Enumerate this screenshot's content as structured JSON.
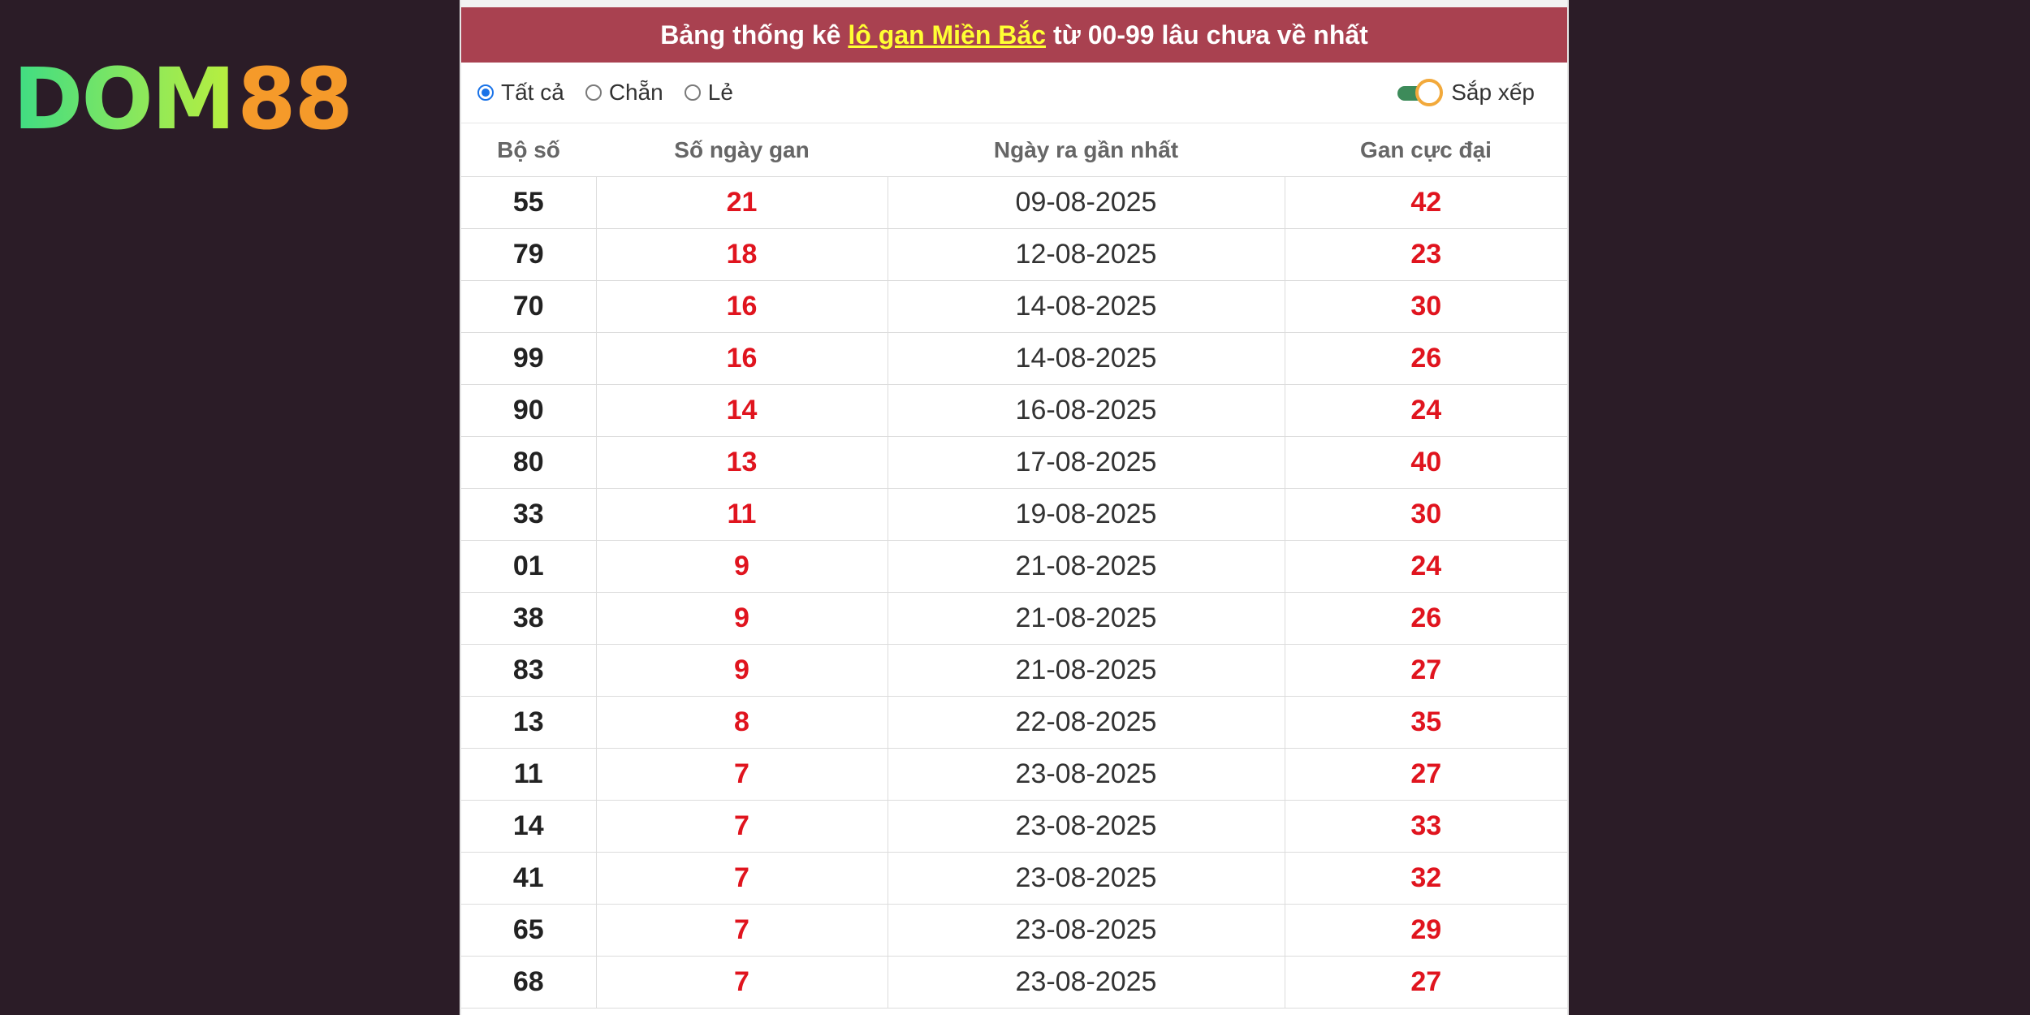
{
  "logo": {
    "part1": "DOM",
    "part2": "88"
  },
  "header": {
    "prefix": "Bảng thống kê",
    "highlight": "lô gan Miền Bắc",
    "suffix": "từ 00-99 lâu chưa về nhất"
  },
  "filters": {
    "options": [
      {
        "label": "Tất cả",
        "checked": true
      },
      {
        "label": "Chẵn",
        "checked": false
      },
      {
        "label": "Lẻ",
        "checked": false
      }
    ],
    "sort_label": "Sắp xếp",
    "sort_on": true
  },
  "table": {
    "columns": [
      "Bộ số",
      "Số ngày gan",
      "Ngày ra gần nhất",
      "Gan cực đại"
    ],
    "rows": [
      [
        "55",
        "21",
        "09-08-2025",
        "42"
      ],
      [
        "79",
        "18",
        "12-08-2025",
        "23"
      ],
      [
        "70",
        "16",
        "14-08-2025",
        "30"
      ],
      [
        "99",
        "16",
        "14-08-2025",
        "26"
      ],
      [
        "90",
        "14",
        "16-08-2025",
        "24"
      ],
      [
        "80",
        "13",
        "17-08-2025",
        "40"
      ],
      [
        "33",
        "11",
        "19-08-2025",
        "30"
      ],
      [
        "01",
        "9",
        "21-08-2025",
        "24"
      ],
      [
        "38",
        "9",
        "21-08-2025",
        "26"
      ],
      [
        "83",
        "9",
        "21-08-2025",
        "27"
      ],
      [
        "13",
        "8",
        "22-08-2025",
        "35"
      ],
      [
        "11",
        "7",
        "23-08-2025",
        "27"
      ],
      [
        "14",
        "7",
        "23-08-2025",
        "33"
      ],
      [
        "41",
        "7",
        "23-08-2025",
        "32"
      ],
      [
        "65",
        "7",
        "23-08-2025",
        "29"
      ],
      [
        "68",
        "7",
        "23-08-2025",
        "27"
      ]
    ]
  },
  "colors": {
    "background": "#2b1c27",
    "header_bar": "#a94150",
    "highlight": "#ffff33",
    "red_value": "#e0141e",
    "toggle_track": "#3d8b5a",
    "toggle_knob_border": "#f2a93b",
    "radio_checked": "#1a73e8"
  }
}
